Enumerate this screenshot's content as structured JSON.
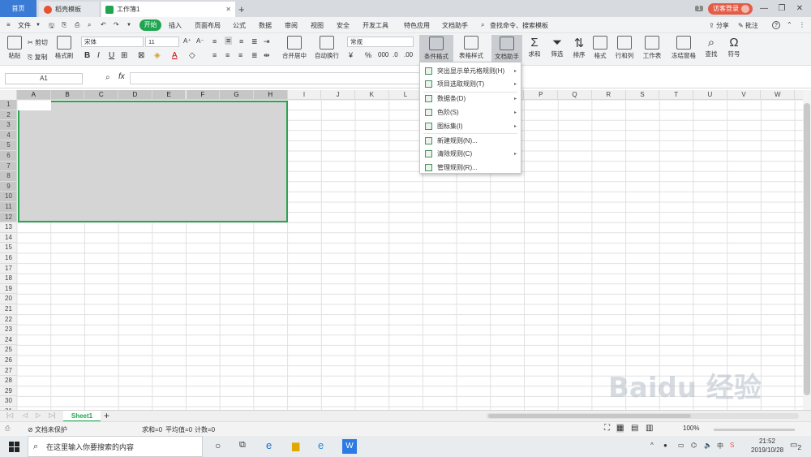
{
  "tabs": {
    "home": "首页",
    "templates": "稻壳模板",
    "workbook": "工作簿1",
    "add": "+",
    "page_badge": "1",
    "login": "访客登录"
  },
  "menu": {
    "file": "文件",
    "start": "开始",
    "items": [
      "插入",
      "页面布局",
      "公式",
      "数据",
      "审阅",
      "视图",
      "安全",
      "开发工具",
      "特色应用",
      "文档助手"
    ],
    "search": "查找命令、搜索模板",
    "share": "分享",
    "comment": "批注",
    "help": "?"
  },
  "ribbon": {
    "paste": "粘贴",
    "cut": "剪切",
    "copy": "复制",
    "format_painter": "格式刷",
    "font_name": "宋体",
    "font_size": "11",
    "merge": "合并居中",
    "wrap": "自动换行",
    "number_format": "常规",
    "cond_format": "条件格式",
    "table_style": "表格样式",
    "doc_assistant": "文档助手",
    "sum": "求和",
    "filter": "筛选",
    "sort": "排序",
    "format": "格式",
    "row_col": "行和列",
    "worksheet": "工作表",
    "freeze": "冻结窗格",
    "find": "查找",
    "symbol": "符号"
  },
  "formula_bar": {
    "name_box": "A1",
    "fx": "fx"
  },
  "grid": {
    "columns": [
      "A",
      "B",
      "C",
      "D",
      "E",
      "F",
      "G",
      "H",
      "I",
      "J",
      "K",
      "L",
      "M",
      "N",
      "O",
      "P",
      "Q",
      "R",
      "S",
      "T",
      "U",
      "V",
      "W"
    ],
    "rows": [
      "1",
      "2",
      "3",
      "4",
      "5",
      "6",
      "7",
      "8",
      "9",
      "10",
      "11",
      "12",
      "13",
      "14",
      "15",
      "16",
      "17",
      "18",
      "19",
      "20",
      "21",
      "22",
      "23",
      "24",
      "25",
      "26",
      "27",
      "28",
      "29",
      "30",
      "31"
    ],
    "selected_columns": [
      "A",
      "B",
      "C",
      "D",
      "E",
      "F",
      "G",
      "H"
    ],
    "selected_rows": 12
  },
  "dropdown": {
    "items": [
      {
        "label": "突出显示单元格规则(H)",
        "submenu": true
      },
      {
        "label": "项目选取规则(T)",
        "submenu": true
      },
      {
        "label": "数据条(D)",
        "submenu": true
      },
      {
        "label": "色阶(S)",
        "submenu": true
      },
      {
        "label": "图标集(I)",
        "submenu": true
      },
      {
        "label": "新建规则(N)...",
        "submenu": false
      },
      {
        "label": "清除规则(C)",
        "submenu": true
      },
      {
        "label": "管理规则(R)...",
        "submenu": false
      }
    ]
  },
  "sheets": {
    "active": "Sheet1",
    "add": "+"
  },
  "status": {
    "protect": "文档未保护",
    "sum": "求和=0",
    "average": "平均值=0",
    "count": "计数=0"
  },
  "taskbar": {
    "search_placeholder": "在这里输入你要搜索的内容",
    "time": "21:52",
    "date": "2019/10/28",
    "ime": "中",
    "notify": "2"
  },
  "watermark": "Baidu 经验",
  "colors": {
    "accent_green": "#1fa550",
    "home_tab": "#3a7bd5",
    "login_red": "#e25c48"
  }
}
